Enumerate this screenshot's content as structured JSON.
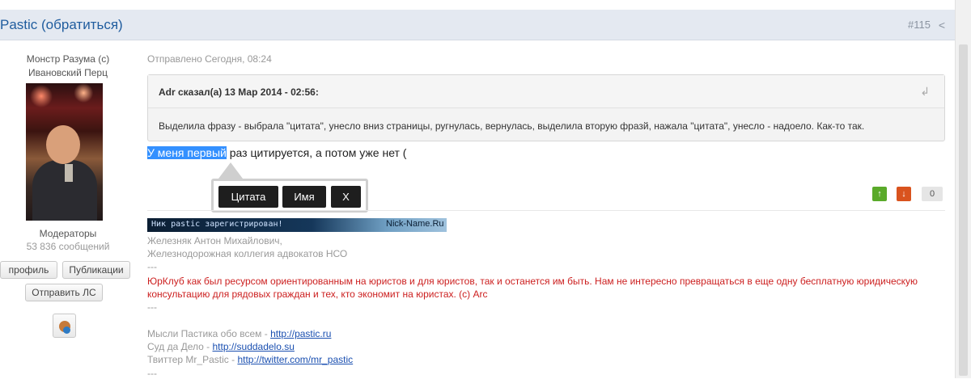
{
  "header": {
    "author_link": "Pastic (обратиться)",
    "post_number": "#115",
    "share_icon": "share-icon"
  },
  "user": {
    "title_line1": "Монстр Разума (с)",
    "title_line2": "Ивановский Перц",
    "group": "Модераторы",
    "post_count": "53 836 сообщений",
    "buttons": {
      "profile": "профиль",
      "publications": "Публикации",
      "send_pm": "Отправить ЛС"
    },
    "icon": "user-icon"
  },
  "post": {
    "posted_at": "Отправлено Сегодня, 08:24",
    "quote": {
      "header": "Adr сказал(а) 13 Мар 2014 - 02:56:",
      "text": "Выделила фразу - выбрала \"цитата\", унесло вниз страницы, ругнулась, вернулась, выделила вторую фразй, нажала \"цитата\", унесло - надоело. Как-то так.",
      "icon": "return-arrow-icon"
    },
    "message_selected": "У меня первый",
    "message_rest": " раз цитируется, а потом уже нет (",
    "popup": {
      "quote_label": "Цитата",
      "name_label": "Имя",
      "close_label": "X"
    },
    "votes": {
      "up": "↑",
      "down": "↓",
      "score": "0"
    }
  },
  "signature": {
    "banner_left": "Ник pastic зарегистрирован!",
    "banner_right": "Nick-Name.Ru",
    "line1": "Железняк Антон Михайлович,",
    "line2": "Железнодорожная коллегия адвокатов НСО",
    "sep1": "---",
    "red_text": "ЮрКлуб как был ресурсом ориентированным на юристов и для юристов, так и останется им быть. Нам не интересно превращаться в еще одну бесплатную юридическую консультацию для рядовых граждан и тех, кто экономит на юристах. (с) Arc",
    "sep2": "---",
    "links": [
      {
        "label": "Мысли Пастика обо всем - ",
        "url": "http://pastic.ru"
      },
      {
        "label": "Суд да Дело - ",
        "url": "http://suddadelo.su"
      },
      {
        "label": "Твиттер Mr_Pastic - ",
        "url": "http://twitter.com/mr_pastic"
      }
    ],
    "sep3": "---"
  }
}
